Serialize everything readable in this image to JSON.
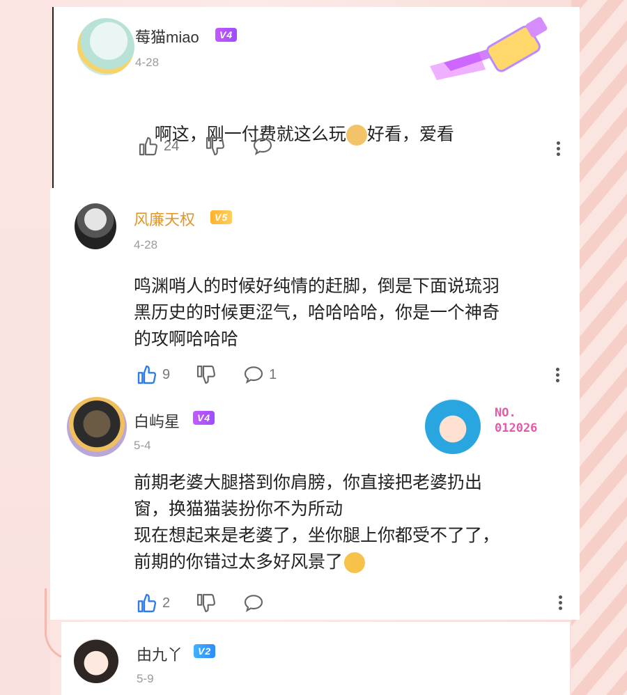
{
  "comments": [
    {
      "username": "莓猫miao",
      "level": "V4",
      "date": "4-28",
      "text_before_emoji": "啊这，刚一付费就这么玩",
      "text_after_emoji": "好看，爱看",
      "likes": "24",
      "liked": false
    },
    {
      "username": "风廉天权",
      "level": "V5",
      "date": "4-28",
      "text": "鸣渊哨人的时候好纯情的赶脚，倒是下面说琉羽\n黑历史的时候更涩气，哈哈哈哈，你是一个神奇\n的攻啊哈哈哈",
      "likes": "9",
      "replies": "1",
      "liked": true
    },
    {
      "username": "白屿星",
      "level": "V4",
      "date": "5-4",
      "text": "前期老婆大腿搭到你肩膀，你直接把老婆扔出\n窗，换猫猫装扮你不为所动\n现在想起来是老婆了，坐你腿上你都受不了了，\n前期的你错过太多好风景了",
      "likes": "2",
      "liked": true,
      "decoration_number": "NO.\n012026"
    },
    {
      "username": "由九丫",
      "level": "V2",
      "date": "5-9"
    }
  ],
  "colors": {
    "liked": "#2f7bea",
    "icon": "#666666",
    "gold_name": "#e2962a"
  },
  "icons": [
    "thumbs-up-icon",
    "thumbs-down-icon",
    "comment-icon",
    "more-icon"
  ]
}
